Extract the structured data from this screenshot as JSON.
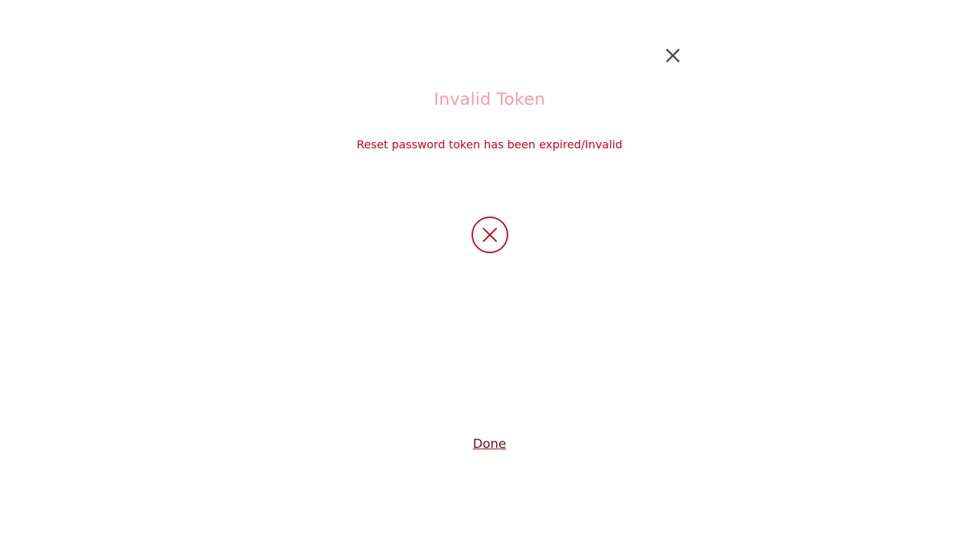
{
  "dialog": {
    "title": "Invalid Token",
    "message": "Reset password token has been expired/Invalid",
    "done_label": "Done",
    "close_icon": "close-icon",
    "status_icon": "error-circle-x-icon"
  },
  "colors": {
    "title": "#f4a0a0",
    "message": "#d0021b",
    "error_icon": "#d0021b",
    "done_link": "#6b0f0f",
    "close_icon": "#4a4a4a"
  }
}
